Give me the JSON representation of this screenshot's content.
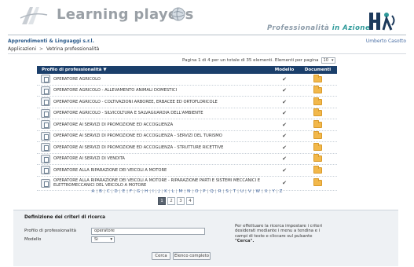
{
  "header": {
    "logo_title": "Learning players",
    "tagline_part1": "Professionalità ",
    "tagline_part2": "in Azione",
    "company": "Apprendimenti & Linguaggi s.r.l.",
    "user": "Umberto Casotto",
    "breadcrumb": [
      "Applicazioni",
      "Vetrina professionalità"
    ],
    "breadcrumb_separator": ">"
  },
  "pager": {
    "info": "Pagina 1 di 4 per un totale di 35 elementi. Elementi per pagina",
    "per_page": "10"
  },
  "table": {
    "columns": {
      "name": "Profilo di professionalità ▼",
      "model": "Modello",
      "docs": "Documenti"
    },
    "rows": [
      {
        "name": "OPERATORE AGRICOLO",
        "model": "✔"
      },
      {
        "name": "OPERATORE AGRICOLO - ALLEVAMENTO ANIMALI DOMESTICI",
        "model": "✔"
      },
      {
        "name": "OPERATORE AGRICOLO - COLTIVAZIONI ARBOREE, ERBACEE ED ORTOFLORICOLE",
        "model": "✔"
      },
      {
        "name": "OPERATORE AGRICOLO - SILVICOLTURA E SALVAGUARDIA DELL'AMBIENTE",
        "model": "✔"
      },
      {
        "name": "OPERATORE AI SERVIZI DI PROMOZIONE ED ACCOGLIENZA",
        "model": "✔"
      },
      {
        "name": "OPERATORE AI SERVIZI DI PROMOZIONE ED ACCOGLIENZA - SERVIZI DEL TURISMO",
        "model": "✔"
      },
      {
        "name": "OPERATORE AI SERVIZI DI PROMOZIONE ED ACCOGLIENZA - STRUTTURE RICETTIVE",
        "model": "✔"
      },
      {
        "name": "OPERATORE AI SERVIZI DI VENDITA",
        "model": "✔"
      },
      {
        "name": "OPERATORE ALLA RIPARAZIONE DEI VEICOLI A MOTORE",
        "model": "✔"
      },
      {
        "name": "OPERATORE ALLA RIPARAZIONE DEI VEICOLI A MOTORE - RIPARAZIONE PARTI E SISTEMI MECCANICI E ELETTROMECCANICI DEL VEICOLO A MOTORE",
        "model": "✔"
      }
    ]
  },
  "alphabet": [
    "A",
    "B",
    "C",
    "D",
    "E",
    "F",
    "G",
    "H",
    "I",
    "J",
    "K",
    "L",
    "M",
    "N",
    "O",
    "P",
    "Q",
    "R",
    "S",
    "T",
    "U",
    "V",
    "W",
    "X",
    "Y",
    "Z"
  ],
  "pages": [
    "1",
    "2",
    "3",
    "4"
  ],
  "search": {
    "title": "Definizione dei criteri di ricerca",
    "profile_label": "Profilo di professionalità",
    "profile_value": "operatore",
    "model_label": "Modello",
    "model_value": "Sì",
    "hint": "Per effettuare la ricerca impostare i criteri desiderati mediante i menu a tendina e i campi di testo e cliccare sul pulsante ",
    "hint_bold": "\"Cerca\".",
    "search_button": "Cerca",
    "full_list_button": "Elenco completo"
  },
  "colors": {
    "header_bar": "#1b3f6b",
    "link": "#3a5f9a",
    "folder": "#f2b84b"
  }
}
